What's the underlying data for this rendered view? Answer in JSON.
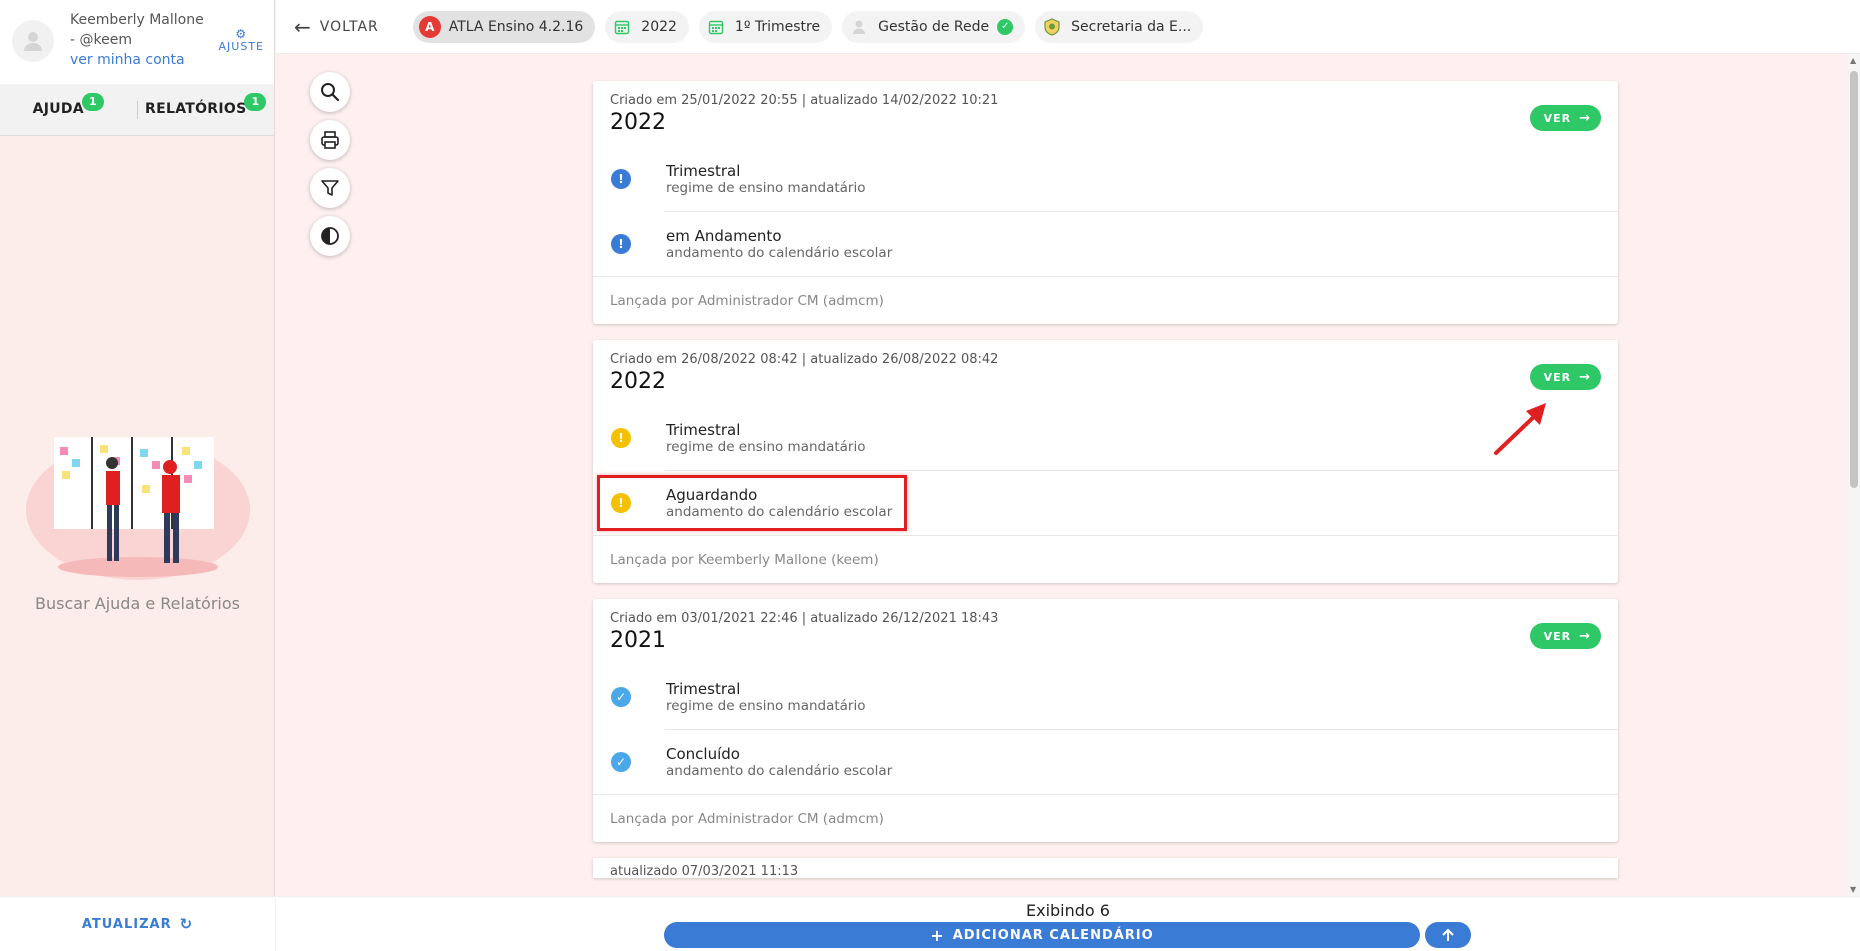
{
  "user": {
    "name_line1": "Keemberly Mallone",
    "name_line2": "- @keem",
    "account_link": "ver minha conta",
    "settings_label": "AJUSTE"
  },
  "sidebar": {
    "tabs": [
      {
        "label": "AJUDA",
        "badge": "1"
      },
      {
        "label": "RELATÓRIOS",
        "badge": "1"
      }
    ],
    "caption": "Buscar Ajuda e Relatórios",
    "refresh_label": "ATUALIZAR"
  },
  "topbar": {
    "back_label": "VOLTAR",
    "chips": [
      {
        "label": "ATLA Ensino 4.2.16",
        "icon": "atla-logo-icon"
      },
      {
        "label": "2022",
        "icon": "calendar-icon"
      },
      {
        "label": "1º Trimestre",
        "icon": "calendar-icon"
      },
      {
        "label": "Gestão de Rede",
        "icon": "user-icon"
      },
      {
        "label": "Secretaria da E...",
        "icon": "seal-icon"
      }
    ]
  },
  "cards": [
    {
      "meta": "Criado em 25/01/2022 20:55 | atualizado 14/02/2022 10:21",
      "year": "2022",
      "ver_label": "VER",
      "rows": [
        {
          "title": "Trimestral",
          "subtitle": "regime de ensino mandatário",
          "status": "info"
        },
        {
          "title": "em Andamento",
          "subtitle": "andamento do calendário escolar",
          "status": "info"
        }
      ],
      "footer": "Lançada por Administrador CM (admcm)"
    },
    {
      "meta": "Criado em 26/08/2022 08:42 | atualizado 26/08/2022 08:42",
      "year": "2022",
      "ver_label": "VER",
      "rows": [
        {
          "title": "Trimestral",
          "subtitle": "regime de ensino mandatário",
          "status": "warning"
        },
        {
          "title": "Aguardando",
          "subtitle": "andamento do calendário escolar",
          "status": "warning"
        }
      ],
      "footer": "Lançada por Keemberly Mallone (keem)"
    },
    {
      "meta": "Criado em 03/01/2021 22:46 | atualizado 26/12/2021 18:43",
      "year": "2021",
      "ver_label": "VER",
      "rows": [
        {
          "title": "Trimestral",
          "subtitle": "regime de ensino mandatário",
          "status": "done"
        },
        {
          "title": "Concluído",
          "subtitle": "andamento do calendário escolar",
          "status": "done"
        }
      ],
      "footer": "Lançada por Administrador CM (admcm)"
    }
  ],
  "peek_text": "atualizado 07/03/2021 11:13",
  "bottombar": {
    "count_label": "Exibindo 6",
    "add_label": "ADICIONAR CALENDÁRIO"
  },
  "colors": {
    "primary": "#3a7bd5",
    "success": "#2ec866",
    "warning": "#f5c000",
    "annotation": "#e02020"
  }
}
